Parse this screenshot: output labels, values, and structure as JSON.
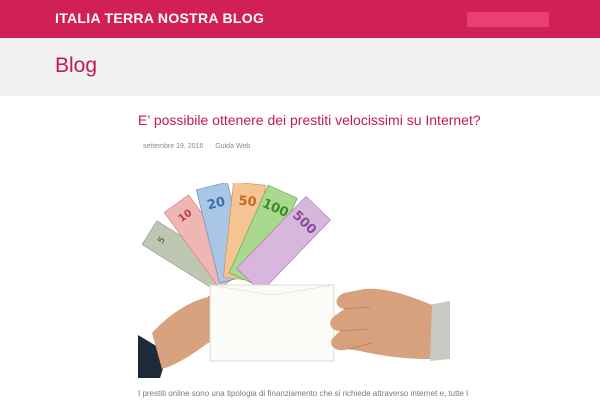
{
  "header": {
    "site_title": "ITALIA TERRA NOSTRA BLOG",
    "search_value": "",
    "brand_color": "#d11f58"
  },
  "page": {
    "heading": "Blog"
  },
  "post": {
    "title": "E’ possibile ottenere dei prestiti velocissimi su Internet?",
    "date": "settembre 19, 2016",
    "category": "Guida Web",
    "excerpt": "I prestiti online sono una tipologia di finanziamento che si richiede attraverso internet e, tutte le",
    "banknotes": [
      "20",
      "50",
      "100",
      "500",
      "10",
      "5"
    ]
  }
}
